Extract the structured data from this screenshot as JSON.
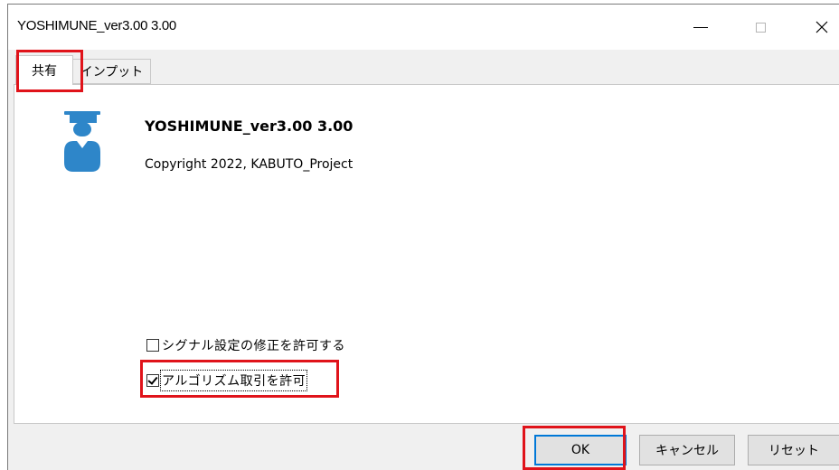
{
  "window": {
    "title": "YOSHIMUNE_ver3.00 3.00",
    "controls": {
      "minimize": "minimize",
      "maximize": "maximize",
      "close": "close"
    }
  },
  "tabs": [
    {
      "label": "共有",
      "selected": true
    },
    {
      "label": "インプット",
      "selected": false
    }
  ],
  "about": {
    "app_name": "YOSHIMUNE_ver3.00 3.00",
    "copyright": "Copyright 2022, KABUTO_Project",
    "logo_icon": "graduate-icon",
    "logo_color": "#2e86c9"
  },
  "options": [
    {
      "label": "シグナル設定の修正を許可する",
      "checked": false
    },
    {
      "label": "アルゴリズム取引を許可",
      "checked": true
    }
  ],
  "buttons": {
    "ok": "OK",
    "cancel": "キャンセル",
    "reset": "リセット"
  },
  "highlight_color": "#e0131a"
}
